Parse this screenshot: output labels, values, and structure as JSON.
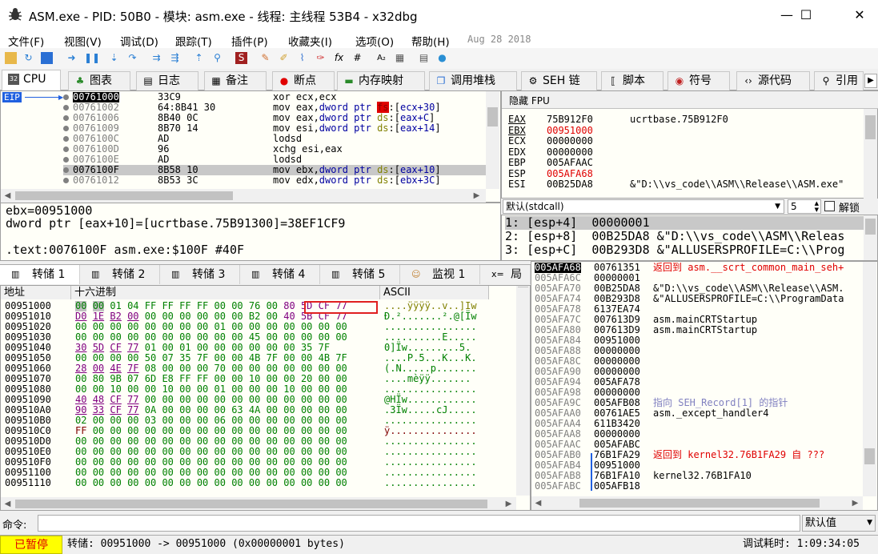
{
  "window": {
    "title": "ASM.exe - PID: 50B0 - 模块: asm.exe - 线程: 主线程 53B4 - x32dbg",
    "minimize": "—",
    "maximize": "☐",
    "close": "✕"
  },
  "menu": {
    "items": [
      "文件(F)",
      "视图(V)",
      "调试(D)",
      "跟踪(T)",
      "插件(P)",
      "收藏夹(I)",
      "选项(O)",
      "帮助(H)"
    ],
    "date": "Aug 28 2018"
  },
  "toolbar": {
    "icons": [
      "open-icon",
      "restart-icon",
      "stop-icon",
      "run-icon",
      "pause-icon",
      "step-into-icon",
      "step-over-icon",
      "trace-into-icon",
      "trace-over-icon",
      "execute-till-return-icon",
      "run-to-user-code-icon",
      "scylla-icon",
      "patch-icon",
      "comment-icon",
      "label-icon",
      "bookmark-icon",
      "function-icon",
      "hash-icon",
      "strings-icon",
      "calculator-icon",
      "globe-icon"
    ],
    "labels": [
      "fx",
      "#",
      "A₂"
    ]
  },
  "tabs": [
    "CPU",
    "图表",
    "日志",
    "备注",
    "断点",
    "内存映射",
    "调用堆栈",
    "SEH 链",
    "脚本",
    "符号",
    "源代码",
    "引用"
  ],
  "disasm": {
    "eip_label": "EIP",
    "rows": [
      {
        "addr": "00761000",
        "bytes": "33C9",
        "instr": "xor ecx,ecx"
      },
      {
        "addr": "00761002",
        "bytes": "64:8B41 30",
        "instr": "mov eax,dword ptr fs:[ecx+30]"
      },
      {
        "addr": "00761006",
        "bytes": "8B40 0C",
        "instr": "mov eax,dword ptr ds:[eax+C]"
      },
      {
        "addr": "00761009",
        "bytes": "8B70 14",
        "instr": "mov esi,dword ptr ds:[eax+14]"
      },
      {
        "addr": "0076100C",
        "bytes": "AD",
        "instr": "lodsd"
      },
      {
        "addr": "0076100D",
        "bytes": "96",
        "instr": "xchg esi,eax"
      },
      {
        "addr": "0076100E",
        "bytes": "AD",
        "instr": "lodsd"
      },
      {
        "addr": "0076100F",
        "bytes": "8B58 10",
        "instr": "mov ebx,dword ptr ds:[eax+10]"
      },
      {
        "addr": "00761012",
        "bytes": "8B53 3C",
        "instr": "mov edx,dword ptr ds:[ebx+3C]"
      }
    ]
  },
  "info": {
    "line1": "ebx=00951000",
    "line2": "dword ptr [eax+10]=[ucrtbase.75B91300]=38EF1CF9",
    "line3": ".text:0076100F asm.exe:$100F #40F"
  },
  "registers": {
    "header": "隐藏 FPU",
    "rows": [
      {
        "name": "EAX",
        "value": "75B912F0",
        "comment": "ucrtbase.75B912F0"
      },
      {
        "name": "EBX",
        "value": "00951000",
        "comment": ""
      },
      {
        "name": "ECX",
        "value": "00000000",
        "comment": ""
      },
      {
        "name": "EDX",
        "value": "00000000",
        "comment": ""
      },
      {
        "name": "EBP",
        "value": "005AFAAC",
        "comment": ""
      },
      {
        "name": "ESP",
        "value": "005AFA68",
        "comment": ""
      },
      {
        "name": "ESI",
        "value": "00B25DA8",
        "comment": "&\"D:\\\\vs_code\\\\ASM\\\\Release\\\\ASM.exe\""
      }
    ]
  },
  "callconv": {
    "selected": "默认(stdcall)",
    "count": "5",
    "unlock": "解锁",
    "rows": [
      "1: [esp+4]  00000001",
      "2: [esp+8]  00B25DA8 &\"D:\\\\vs_code\\\\ASM\\\\Releas",
      "3: [esp+C]  00B293D8 &\"ALLUSERSPROFILE=C:\\\\Prog"
    ]
  },
  "dump_tabs": [
    "转储 1",
    "转储 2",
    "转储 3",
    "转储 4",
    "转储 5",
    "监视 1",
    "局"
  ],
  "dump": {
    "headers": {
      "addr": "地址",
      "hex": "十六进制",
      "ascii": "ASCII"
    },
    "rows": [
      {
        "addr": "00951000",
        "hex": "00 00 01 04 FF FF FF FF 00 00 76 00 80 5D CF 77",
        "ascii": "....ÿÿÿÿ..v..]Ïw"
      },
      {
        "addr": "00951010",
        "hex": "D0 1E B2 00 00 00 00 00 00 00 B2 00 40 5B CF 77",
        "ascii": "Ð.².......².@[Ïw"
      },
      {
        "addr": "00951020",
        "hex": "00 00 00 00 00 00 00 00 01 00 00 00 00 00 00 00",
        "ascii": "................"
      },
      {
        "addr": "00951030",
        "hex": "00 00 00 00 00 00 00 00 00 00 45 00 00 00 00 00",
        "ascii": "..........E....."
      },
      {
        "addr": "00951040",
        "hex": "30 5D CF 77 01 00 01 00 00 00 00 00 00 35 7F",
        "ascii": "0]Ïw.........5."
      },
      {
        "addr": "00951050",
        "hex": "00 00 00 00 50 07 35 7F 00 00 4B 7F 00 00 4B 7F",
        "ascii": "....P.5...K...K."
      },
      {
        "addr": "00951060",
        "hex": "28 00 4E 7F 08 00 00 00 70 00 00 00 00 00 00 00",
        "ascii": "(.N.....p......."
      },
      {
        "addr": "00951070",
        "hex": "00 80 9B 07 6D E8 FF FF 00 00 10 00 00 20 00 00",
        "ascii": "....mèÿÿ....... "
      },
      {
        "addr": "00951080",
        "hex": "00 00 10 00 00 10 00 00 01 00 00 00 10 00 00 00",
        "ascii": "................"
      },
      {
        "addr": "00951090",
        "hex": "40 48 CF 77 00 00 00 00 00 00 00 00 00 00 00 00",
        "ascii": "@HÏw............"
      },
      {
        "addr": "009510A0",
        "hex": "90 33 CF 77 0A 00 00 00 00 63 4A 00 00 00 00 00",
        "ascii": ".3Ïw.....cJ....."
      },
      {
        "addr": "009510B0",
        "hex": "02 00 00 00 03 00 00 00 06 00 00 00 00 00 00 00",
        "ascii": "................"
      },
      {
        "addr": "009510C0",
        "hex": "FF 00 00 00 00 00 00 00 00 00 00 00 00 00 00 00",
        "ascii": "ÿ..............."
      },
      {
        "addr": "009510D0",
        "hex": "00 00 00 00 00 00 00 00 00 00 00 00 00 00 00 00",
        "ascii": "................"
      },
      {
        "addr": "009510E0",
        "hex": "00 00 00 00 00 00 00 00 00 00 00 00 00 00 00 00",
        "ascii": "................"
      },
      {
        "addr": "009510F0",
        "hex": "00 00 00 00 00 00 00 00 00 00 00 00 00 00 00 00",
        "ascii": "................"
      },
      {
        "addr": "00951100",
        "hex": "00 00 00 00 00 00 00 00 00 00 00 00 00 00 00 00",
        "ascii": "................"
      },
      {
        "addr": "00951110",
        "hex": "00 00 00 00 00 00 00 00 00 00 00 00 00 00 00 00",
        "ascii": "................"
      }
    ]
  },
  "stack": {
    "rows": [
      {
        "addr": "005AFA68",
        "value": "00761351",
        "comment": "返回到 asm.__scrt_common_main_seh+"
      },
      {
        "addr": "005AFA6C",
        "value": "00000001",
        "comment": ""
      },
      {
        "addr": "005AFA70",
        "value": "00B25DA8",
        "comment": "&\"D:\\\\vs_code\\\\ASM\\\\Release\\\\ASM."
      },
      {
        "addr": "005AFA74",
        "value": "00B293D8",
        "comment": "&\"ALLUSERSPROFILE=C:\\\\ProgramData"
      },
      {
        "addr": "005AFA78",
        "value": "6137EA74",
        "comment": ""
      },
      {
        "addr": "005AFA7C",
        "value": "007613D9",
        "comment": "asm.mainCRTStartup"
      },
      {
        "addr": "005AFA80",
        "value": "007613D9",
        "comment": "asm.mainCRTStartup"
      },
      {
        "addr": "005AFA84",
        "value": "00951000",
        "comment": ""
      },
      {
        "addr": "005AFA88",
        "value": "00000000",
        "comment": ""
      },
      {
        "addr": "005AFA8C",
        "value": "00000000",
        "comment": ""
      },
      {
        "addr": "005AFA90",
        "value": "00000000",
        "comment": ""
      },
      {
        "addr": "005AFA94",
        "value": "005AFA78",
        "comment": ""
      },
      {
        "addr": "005AFA98",
        "value": "00000000",
        "comment": ""
      },
      {
        "addr": "005AFA9C",
        "value": "005AFB08",
        "comment": "指向 SEH_Record[1] 的指针"
      },
      {
        "addr": "005AFAA0",
        "value": "00761AE5",
        "comment": "asm._except_handler4"
      },
      {
        "addr": "005AFAA4",
        "value": "611B3420",
        "comment": ""
      },
      {
        "addr": "005AFAA8",
        "value": "00000000",
        "comment": ""
      },
      {
        "addr": "005AFAAC",
        "value": "005AFABC",
        "comment": ""
      },
      {
        "addr": "005AFAB0",
        "value": "76B1FA29",
        "comment": "返回到 kernel32.76B1FA29 自 ???"
      },
      {
        "addr": "005AFAB4",
        "value": "00951000",
        "comment": ""
      },
      {
        "addr": "005AFAB8",
        "value": "76B1FA10",
        "comment": "kernel32.76B1FA10"
      },
      {
        "addr": "005AFABC",
        "value": "005AFB18",
        "comment": ""
      }
    ]
  },
  "command": {
    "label": "命令:",
    "value": "",
    "default": "默认值"
  },
  "status": {
    "state": "已暂停",
    "message": "转储: 00951000 -> 00951000 (0x00000001 bytes)",
    "timer": "调试耗时: 1:09:34:05"
  }
}
